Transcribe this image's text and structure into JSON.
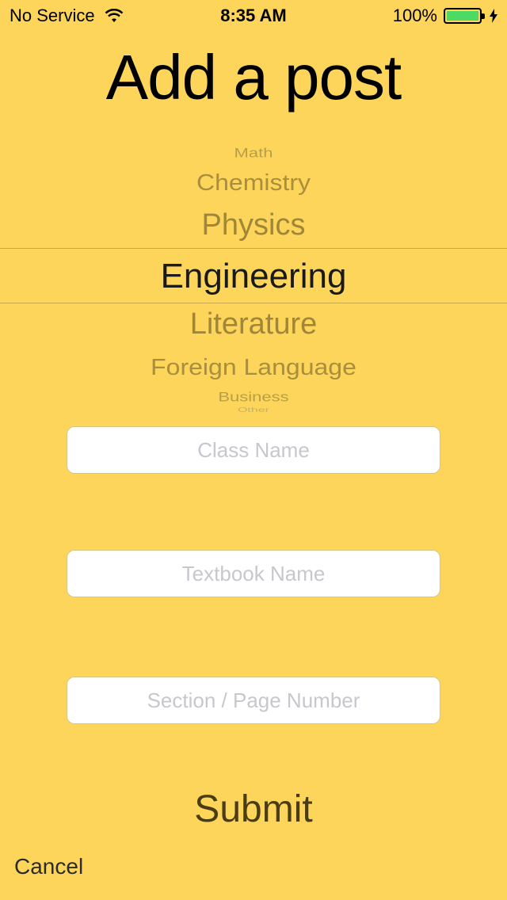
{
  "status_bar": {
    "carrier": "No Service",
    "time": "8:35 AM",
    "battery_percent": "100%",
    "battery_color": "#4cd964"
  },
  "title": "Add a post",
  "picker": {
    "items": [
      "Math",
      "Chemistry",
      "Physics",
      "Engineering",
      "Literature",
      "Foreign Language",
      "Business",
      "Other"
    ],
    "selected": "Engineering"
  },
  "form": {
    "class_name_placeholder": "Class Name",
    "textbook_name_placeholder": "Textbook Name",
    "section_page_placeholder": "Section / Page Number",
    "submit_label": "Submit",
    "cancel_label": "Cancel"
  },
  "colors": {
    "background": "#fdd55a"
  }
}
